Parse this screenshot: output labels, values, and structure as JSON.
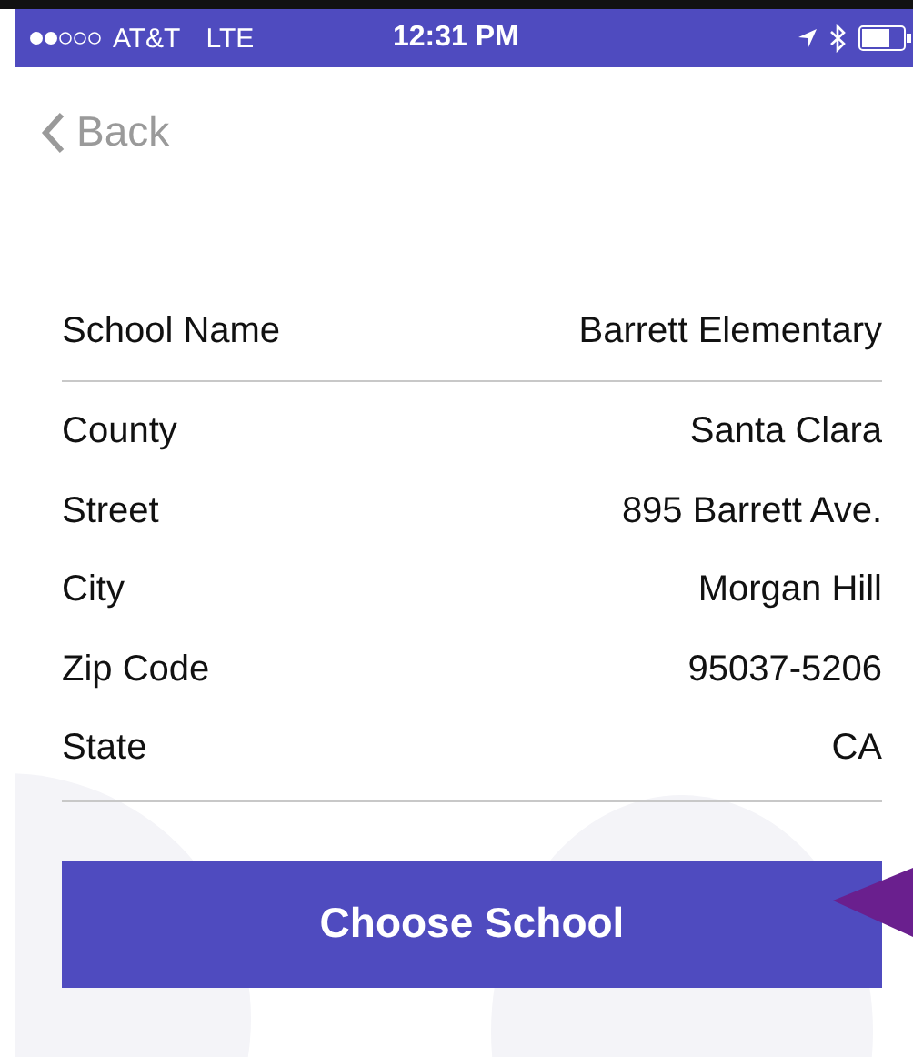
{
  "status_bar": {
    "carrier": "AT&T",
    "network": "LTE",
    "time": "12:31 PM"
  },
  "nav": {
    "back": "Back"
  },
  "school_name": {
    "label": "School Name",
    "value": "Barrett Elementary"
  },
  "details": [
    {
      "label": "County",
      "value": "Santa Clara"
    },
    {
      "label": "Street",
      "value": "895 Barrett Ave."
    },
    {
      "label": "City",
      "value": "Morgan Hill"
    },
    {
      "label": "Zip Code",
      "value": "95037-5206"
    },
    {
      "label": "State",
      "value": "CA"
    }
  ],
  "button": "Choose School"
}
